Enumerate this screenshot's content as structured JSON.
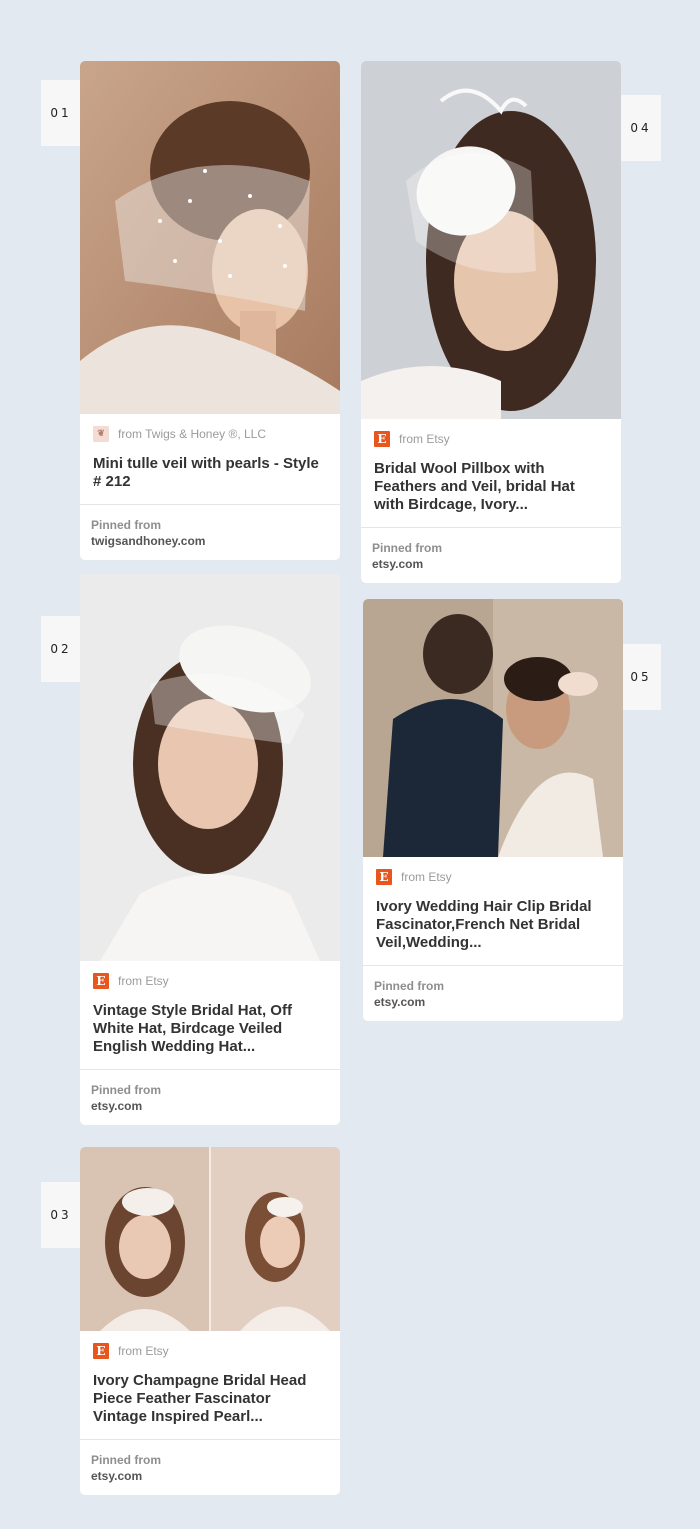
{
  "pins": [
    {
      "number": "01",
      "source_icon": "twigs-honey-logo-icon",
      "source": "from Twigs & Honey ®, LLC",
      "title": "Mini tulle veil with pearls - Style # 212",
      "pinned_label": "Pinned from",
      "pinned_domain": "twigsandhoney.com"
    },
    {
      "number": "02",
      "source_icon": "etsy-logo-icon",
      "source": "from Etsy",
      "title": "Vintage Style Bridal Hat, Off White Hat, Birdcage Veiled English Wedding Hat...",
      "pinned_label": "Pinned from",
      "pinned_domain": "etsy.com"
    },
    {
      "number": "03",
      "source_icon": "etsy-logo-icon",
      "source": "from Etsy",
      "title": "Ivory Champagne Bridal Head Piece Feather Fascinator Vintage Inspired Pearl...",
      "pinned_label": "Pinned from",
      "pinned_domain": "etsy.com"
    },
    {
      "number": "04",
      "source_icon": "etsy-logo-icon",
      "source": "from Etsy",
      "title": "Bridal Wool Pillbox with Feathers and Veil, bridal Hat with Birdcage, Ivory...",
      "pinned_label": "Pinned from",
      "pinned_domain": "etsy.com"
    },
    {
      "number": "05",
      "source_icon": "etsy-logo-icon",
      "source": "from Etsy",
      "title": "Ivory Wedding Hair Clip Bridal Fascinator,French Net Bridal Veil,Wedding...",
      "pinned_label": "Pinned from",
      "pinned_domain": "etsy.com"
    }
  ],
  "colors": {
    "page_background": "#e3e9f0",
    "etsy_orange": "#e8561e"
  }
}
